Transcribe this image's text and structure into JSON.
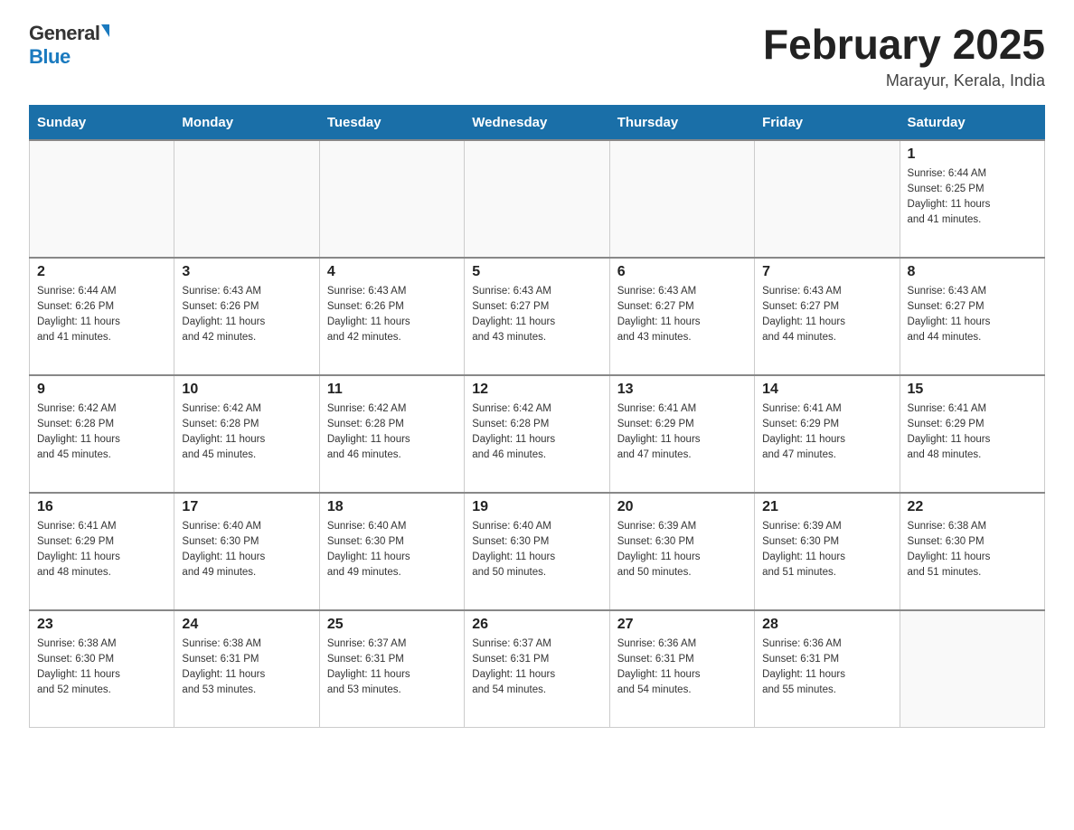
{
  "header": {
    "logo_general": "General",
    "logo_blue": "Blue",
    "title": "February 2025",
    "subtitle": "Marayur, Kerala, India"
  },
  "weekdays": [
    "Sunday",
    "Monday",
    "Tuesday",
    "Wednesday",
    "Thursday",
    "Friday",
    "Saturday"
  ],
  "weeks": [
    [
      {
        "day": "",
        "info": ""
      },
      {
        "day": "",
        "info": ""
      },
      {
        "day": "",
        "info": ""
      },
      {
        "day": "",
        "info": ""
      },
      {
        "day": "",
        "info": ""
      },
      {
        "day": "",
        "info": ""
      },
      {
        "day": "1",
        "info": "Sunrise: 6:44 AM\nSunset: 6:25 PM\nDaylight: 11 hours\nand 41 minutes."
      }
    ],
    [
      {
        "day": "2",
        "info": "Sunrise: 6:44 AM\nSunset: 6:26 PM\nDaylight: 11 hours\nand 41 minutes."
      },
      {
        "day": "3",
        "info": "Sunrise: 6:43 AM\nSunset: 6:26 PM\nDaylight: 11 hours\nand 42 minutes."
      },
      {
        "day": "4",
        "info": "Sunrise: 6:43 AM\nSunset: 6:26 PM\nDaylight: 11 hours\nand 42 minutes."
      },
      {
        "day": "5",
        "info": "Sunrise: 6:43 AM\nSunset: 6:27 PM\nDaylight: 11 hours\nand 43 minutes."
      },
      {
        "day": "6",
        "info": "Sunrise: 6:43 AM\nSunset: 6:27 PM\nDaylight: 11 hours\nand 43 minutes."
      },
      {
        "day": "7",
        "info": "Sunrise: 6:43 AM\nSunset: 6:27 PM\nDaylight: 11 hours\nand 44 minutes."
      },
      {
        "day": "8",
        "info": "Sunrise: 6:43 AM\nSunset: 6:27 PM\nDaylight: 11 hours\nand 44 minutes."
      }
    ],
    [
      {
        "day": "9",
        "info": "Sunrise: 6:42 AM\nSunset: 6:28 PM\nDaylight: 11 hours\nand 45 minutes."
      },
      {
        "day": "10",
        "info": "Sunrise: 6:42 AM\nSunset: 6:28 PM\nDaylight: 11 hours\nand 45 minutes."
      },
      {
        "day": "11",
        "info": "Sunrise: 6:42 AM\nSunset: 6:28 PM\nDaylight: 11 hours\nand 46 minutes."
      },
      {
        "day": "12",
        "info": "Sunrise: 6:42 AM\nSunset: 6:28 PM\nDaylight: 11 hours\nand 46 minutes."
      },
      {
        "day": "13",
        "info": "Sunrise: 6:41 AM\nSunset: 6:29 PM\nDaylight: 11 hours\nand 47 minutes."
      },
      {
        "day": "14",
        "info": "Sunrise: 6:41 AM\nSunset: 6:29 PM\nDaylight: 11 hours\nand 47 minutes."
      },
      {
        "day": "15",
        "info": "Sunrise: 6:41 AM\nSunset: 6:29 PM\nDaylight: 11 hours\nand 48 minutes."
      }
    ],
    [
      {
        "day": "16",
        "info": "Sunrise: 6:41 AM\nSunset: 6:29 PM\nDaylight: 11 hours\nand 48 minutes."
      },
      {
        "day": "17",
        "info": "Sunrise: 6:40 AM\nSunset: 6:30 PM\nDaylight: 11 hours\nand 49 minutes."
      },
      {
        "day": "18",
        "info": "Sunrise: 6:40 AM\nSunset: 6:30 PM\nDaylight: 11 hours\nand 49 minutes."
      },
      {
        "day": "19",
        "info": "Sunrise: 6:40 AM\nSunset: 6:30 PM\nDaylight: 11 hours\nand 50 minutes."
      },
      {
        "day": "20",
        "info": "Sunrise: 6:39 AM\nSunset: 6:30 PM\nDaylight: 11 hours\nand 50 minutes."
      },
      {
        "day": "21",
        "info": "Sunrise: 6:39 AM\nSunset: 6:30 PM\nDaylight: 11 hours\nand 51 minutes."
      },
      {
        "day": "22",
        "info": "Sunrise: 6:38 AM\nSunset: 6:30 PM\nDaylight: 11 hours\nand 51 minutes."
      }
    ],
    [
      {
        "day": "23",
        "info": "Sunrise: 6:38 AM\nSunset: 6:30 PM\nDaylight: 11 hours\nand 52 minutes."
      },
      {
        "day": "24",
        "info": "Sunrise: 6:38 AM\nSunset: 6:31 PM\nDaylight: 11 hours\nand 53 minutes."
      },
      {
        "day": "25",
        "info": "Sunrise: 6:37 AM\nSunset: 6:31 PM\nDaylight: 11 hours\nand 53 minutes."
      },
      {
        "day": "26",
        "info": "Sunrise: 6:37 AM\nSunset: 6:31 PM\nDaylight: 11 hours\nand 54 minutes."
      },
      {
        "day": "27",
        "info": "Sunrise: 6:36 AM\nSunset: 6:31 PM\nDaylight: 11 hours\nand 54 minutes."
      },
      {
        "day": "28",
        "info": "Sunrise: 6:36 AM\nSunset: 6:31 PM\nDaylight: 11 hours\nand 55 minutes."
      },
      {
        "day": "",
        "info": ""
      }
    ]
  ]
}
